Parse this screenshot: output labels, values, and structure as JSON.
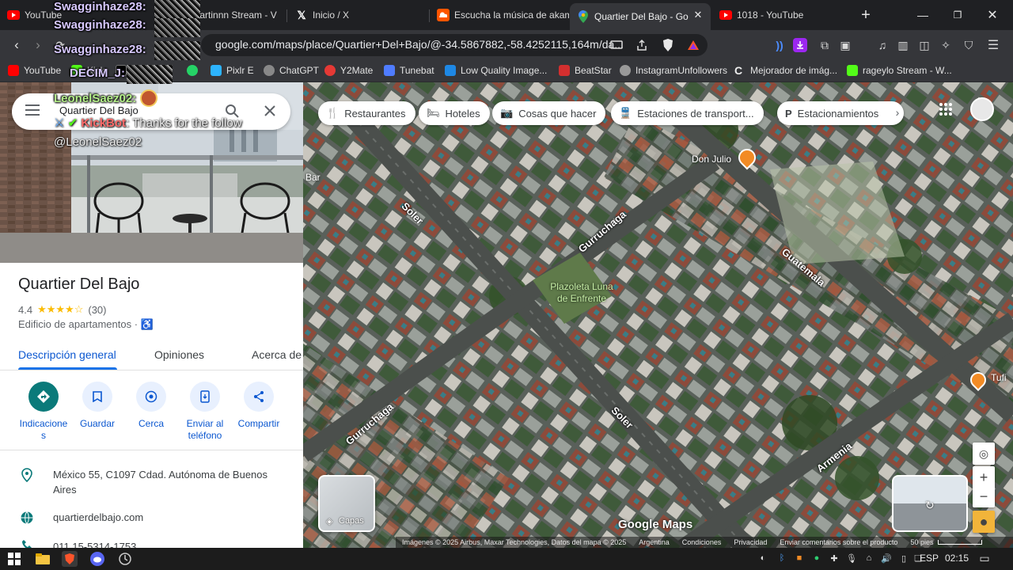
{
  "browser": {
    "tabs": [
      {
        "title": "YouTube",
        "favicon": "youtube-icon",
        "color": "#ff0000"
      },
      {
        "title": "akamartinnn Stream - V",
        "favicon": "kick-icon",
        "color": "#53fc18"
      },
      {
        "title": "Inicio / X",
        "favicon": "x-icon",
        "color": "#ffffff"
      },
      {
        "title": "Escucha la música de akam",
        "favicon": "soundcloud-icon",
        "color": "#ff5500"
      },
      {
        "title": "Quartier Del Bajo - Go",
        "favicon": "maps-icon",
        "color": "#34a853",
        "active": true
      },
      {
        "title": "1018 - YouTube",
        "favicon": "youtube-icon",
        "color": "#ff0000"
      }
    ],
    "new_tab_label": "+",
    "url": "google.com/maps/place/Quartier+Del+Bajo/@-34.5867882,-58.4252115,164m/da...",
    "bookmarks": [
      {
        "label": "YouTube",
        "color": "#ff0000"
      },
      {
        "label": "Kick",
        "color": "#53fc18"
      },
      {
        "label": "",
        "color": "#000000"
      },
      {
        "label": "",
        "color": "#25d366"
      },
      {
        "label": "Pixlr E",
        "color": "#2db4ff"
      },
      {
        "label": "ChatGPT",
        "color": "#888888"
      },
      {
        "label": "Y2Mate",
        "color": "#e53935"
      },
      {
        "label": "Tunebat",
        "color": "#4f7cff"
      },
      {
        "label": "Low Quality Image...",
        "color": "#1e88e5"
      },
      {
        "label": "BeatStar",
        "color": "#d32f2f"
      },
      {
        "label": "InstagramUnfollowers",
        "color": "#999999"
      },
      {
        "label": "Mejorador de imág...",
        "color": "#eeeeee"
      },
      {
        "label": "rageylo Stream - W...",
        "color": "#53fc18"
      }
    ]
  },
  "chat_overlay": {
    "names": [
      "Swagginhaze28:",
      "Swagginhaze28:",
      "Swagginhaze28:",
      "DECIM_J:"
    ],
    "user2": "LeonelSaez02:",
    "bot_name": "KickBot",
    "bot_message": ": Thanks for the follow",
    "bot_mention": "@LeonelSaez02"
  },
  "place": {
    "search_value": "Quartier Del Bajo",
    "title": "Quartier Del Bajo",
    "rating": "4.4",
    "stars": "★★★★☆",
    "review_count": "(30)",
    "category": "Edificio de apartamentos",
    "tabs": [
      "Descripción general",
      "Opiniones",
      "Acerca de"
    ],
    "actions": [
      {
        "label": "Indicaciones",
        "icon": "directions-icon"
      },
      {
        "label": "Guardar",
        "icon": "bookmark-icon"
      },
      {
        "label": "Cerca",
        "icon": "nearby-icon"
      },
      {
        "label": "Enviar al teléfono",
        "icon": "send-to-phone-icon"
      },
      {
        "label": "Compartir",
        "icon": "share-icon"
      }
    ],
    "address": "México 55, C1097 Cdad. Autónoma de Buenos Aires",
    "website": "quartierdelbajo.com",
    "phone": "011 15-5314-1753"
  },
  "map": {
    "chips": [
      "Restaurantes",
      "Hoteles",
      "Cosas que hacer",
      "Estaciones de transport...",
      "Estacionamientos"
    ],
    "streets": [
      "Soler",
      "Gurruchaga",
      "Guatemala",
      "Gurruchaga",
      "Soler",
      "Armenia"
    ],
    "pois": [
      "Don Julio",
      "Plazoleta Luna de Enfrente",
      "Tufi",
      "Bar"
    ],
    "layers_label": "Capas",
    "attribution": [
      "Imágenes © 2025 Airbus, Maxar Technologies, Datos del mapa © 2025",
      "Argentina",
      "Condiciones",
      "Privacidad",
      "Enviar comentarios sobre el producto",
      "50 pies"
    ],
    "logo": "Google Maps"
  },
  "taskbar": {
    "lang": "ESP",
    "time": "02:15"
  }
}
